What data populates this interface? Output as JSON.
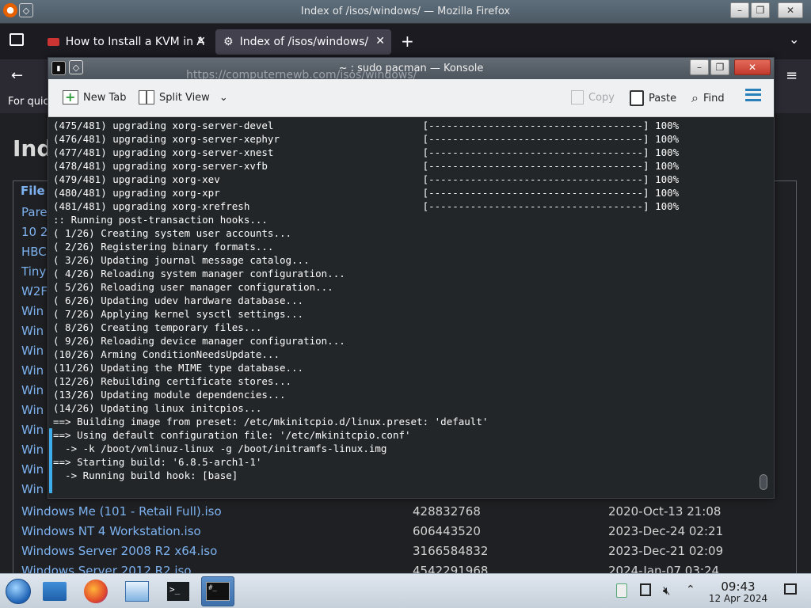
{
  "firefox": {
    "window_title": "Index of /isos/windows/ — Mozilla Firefox",
    "tabs": [
      {
        "label": "How to Install a KVM in A"
      },
      {
        "label": "Index of /isos/windows/"
      }
    ],
    "new_tab_glyph": "+",
    "bookmarks_text": "For quic",
    "page_title": "Ind",
    "column_header": "File",
    "left_links": [
      "Pare",
      "10 2",
      "HBC",
      "Tiny",
      "W2F",
      "Win",
      "Win",
      "Win",
      "Win",
      "Win",
      "Win",
      "Win",
      "Win",
      "Win",
      "Win"
    ],
    "rows": [
      {
        "name": "Windows Me (101 - Retail Full).iso",
        "size": "428832768",
        "date": "2020-Oct-13 21:08"
      },
      {
        "name": "Windows NT 4 Workstation.iso",
        "size": "606443520",
        "date": "2023-Dec-24 02:21"
      },
      {
        "name": "Windows Server 2008 R2 x64.iso",
        "size": "3166584832",
        "date": "2023-Dec-21 02:09"
      },
      {
        "name": "Windows Server 2012 R2.iso",
        "size": "4542291968",
        "date": "2024-Jan-07 03:24"
      }
    ]
  },
  "konsole": {
    "window_title": "~ : sudo pacman — Konsole",
    "underlying_url": "https://computernewb.com/isos/windows/",
    "toolbar": {
      "new_tab": "New Tab",
      "split_view": "Split View",
      "copy": "Copy",
      "paste": "Paste",
      "find": "Find"
    },
    "lines": [
      "(475/481) upgrading xorg-server-devel                         [------------------------------------] 100%",
      "(476/481) upgrading xorg-server-xephyr                        [------------------------------------] 100%",
      "(477/481) upgrading xorg-server-xnest                         [------------------------------------] 100%",
      "(478/481) upgrading xorg-server-xvfb                          [------------------------------------] 100%",
      "(479/481) upgrading xorg-xev                                  [------------------------------------] 100%",
      "(480/481) upgrading xorg-xpr                                  [------------------------------------] 100%",
      "(481/481) upgrading xorg-xrefresh                             [------------------------------------] 100%",
      ":: Running post-transaction hooks...",
      "( 1/26) Creating system user accounts...",
      "( 2/26) Registering binary formats...",
      "( 3/26) Updating journal message catalog...",
      "( 4/26) Reloading system manager configuration...",
      "( 5/26) Reloading user manager configuration...",
      "( 6/26) Updating udev hardware database...",
      "( 7/26) Applying kernel sysctl settings...",
      "( 8/26) Creating temporary files...",
      "( 9/26) Reloading device manager configuration...",
      "(10/26) Arming ConditionNeedsUpdate...",
      "(11/26) Updating the MIME type database...",
      "(12/26) Rebuilding certificate stores...",
      "(13/26) Updating module dependencies...",
      "(14/26) Updating linux initcpios...",
      "==> Building image from preset: /etc/mkinitcpio.d/linux.preset: 'default'",
      "==> Using default configuration file: '/etc/mkinitcpio.conf'",
      "  -> -k /boot/vmlinuz-linux -g /boot/initramfs-linux.img",
      "==> Starting build: '6.8.5-arch1-1'",
      "  -> Running build hook: [base]"
    ]
  },
  "taskbar": {
    "clock_time": "09:43",
    "clock_date": "12 Apr 2024"
  },
  "colors": {
    "accent": "#3daee9",
    "link": "#7db2f0",
    "terminal_bg": "#232629"
  }
}
